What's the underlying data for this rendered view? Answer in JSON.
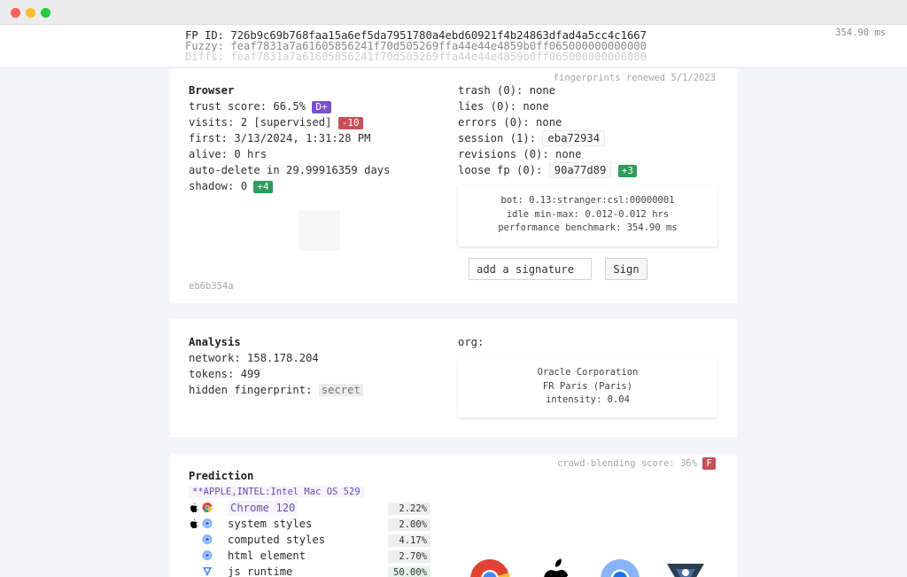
{
  "header": {
    "fp_id": "FP ID: 726b9c69b768faa15a6ef5da7951780a4ebd60921f4b24863dfad4a5cc4c1667",
    "fuzzy": "Fuzzy: feaf7831a7a61605856241f70d505269ffa44e44e4859b0ff065000000000000",
    "diffs": "Diffs: feaf7831a7a61605856241f70d505269ffa44e44e4859b0ff065000000000000",
    "timing": "354.90 ms"
  },
  "browser": {
    "renewed": "fingerprints renewed 5/1/2023",
    "title": "Browser",
    "trust_label": "trust score: 66.5%",
    "trust_grade": "D+",
    "visits_label": "visits: 2 [supervised]",
    "visits_delta": "-10",
    "first": "first: 3/13/2024, 1:31:28 PM",
    "alive": "alive: 0 hrs",
    "auto_delete": "auto-delete in 29.99916359 days",
    "shadow_label": "shadow: 0",
    "shadow_delta": "+4",
    "hash": "eb6b354a",
    "trash": "trash (0): none",
    "lies": "lies (0): none",
    "errors": "errors (0): none",
    "session_label": "session (1):",
    "session_value": "eba72934",
    "revisions": "revisions (0): none",
    "loose_label": "loose fp (0):",
    "loose_value": "90a77d89",
    "loose_delta": "+3",
    "bot": "bot: 0.13:stranger:csl:00000001",
    "idle": "idle min-max: 0.012-0.012 hrs",
    "benchmark": "performance benchmark: 354.90 ms",
    "signature_placeholder": "add a signature",
    "sign_button": "Sign"
  },
  "analysis": {
    "title": "Analysis",
    "network": "network: 158.178.204",
    "tokens": "tokens: 499",
    "hidden_label": "hidden fingerprint:",
    "hidden_value": "secret",
    "org_label": "org:",
    "org_name": "Oracle Corporation",
    "org_location": "FR Paris (Paris)",
    "org_intensity": "intensity: 0.04"
  },
  "prediction": {
    "title": "Prediction",
    "crowd_label": "crowd-blending score: 36%",
    "crowd_grade": "F",
    "os_tag": "**APPLE,INTEL:Intel Mac OS 529",
    "rows": [
      {
        "label": "Chrome 120",
        "pct": "2.22%",
        "icons": [
          "apple-icon",
          "chrome-icon"
        ]
      },
      {
        "label": "system styles",
        "pct": "2.00%",
        "icons": [
          "apple-icon",
          "chromium-icon"
        ]
      },
      {
        "label": "computed styles",
        "pct": "4.17%",
        "icons": [
          "chromium-icon"
        ]
      },
      {
        "label": "html element",
        "pct": "2.70%",
        "icons": [
          "chromium-icon"
        ]
      },
      {
        "label": "js runtime",
        "pct": "50.00%",
        "icons": [
          "v8-icon"
        ]
      }
    ]
  },
  "colors": {
    "purple_badge": "#7a53c8",
    "red_badge": "#c7505a",
    "green_badge": "#2e9b5a"
  }
}
